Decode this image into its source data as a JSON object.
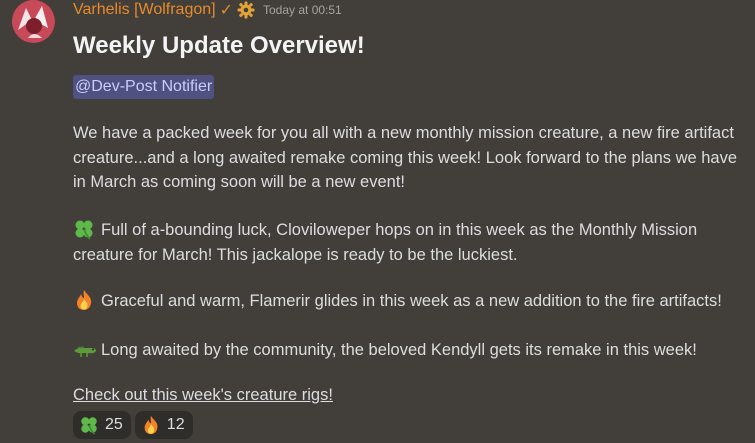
{
  "message": {
    "author": "Varhelis [Wolfragon]",
    "verified_mark": "✓",
    "badge_icon": "gear-icon",
    "timestamp": "Today at 00:51",
    "username_color": "#e78a2a",
    "title": "Weekly Update Overview!",
    "mention": "@Dev-Post Notifier",
    "intro": "We have a packed week for you all with a new monthly mission creature, a new fire artifact creature...and a long awaited remake coming this week! Look forward to the plans we have in March as coming soon will be a new event!",
    "items": [
      {
        "icon": "four-leaf-clover-icon",
        "text": "Full of a-bounding luck, Cloviloweper hops on in this week as the Monthly Mission creature for March! This jackalope is ready to be the luckiest."
      },
      {
        "icon": "fire-icon",
        "text": "Graceful and warm, Flamerir glides in this week as a new addition to the fire artifacts!"
      },
      {
        "icon": "crocodile-icon",
        "text": "Long awaited by the community, the beloved Kendyll gets its remake in this week!"
      }
    ],
    "link_text": "Check out this week's creature rigs!",
    "reactions": [
      {
        "icon": "four-leaf-clover-icon",
        "count": "25"
      },
      {
        "icon": "fire-icon",
        "count": "12"
      }
    ]
  }
}
